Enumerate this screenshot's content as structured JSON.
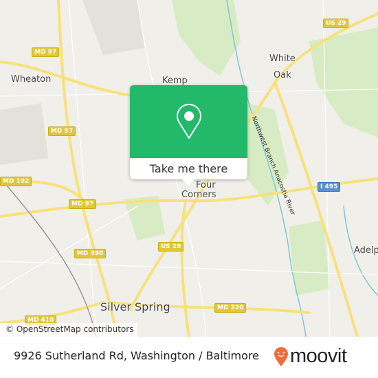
{
  "map": {
    "places": [
      {
        "name": "Wheaton",
        "id": "wheaton"
      },
      {
        "name": "Kemp",
        "id": "kemp"
      },
      {
        "name": "White",
        "id": "white"
      },
      {
        "name": "Oak",
        "id": "oak"
      },
      {
        "name": "Four",
        "id": "four"
      },
      {
        "name": "Corners",
        "id": "corners"
      },
      {
        "name": "Silver Spring",
        "id": "silver-spring"
      },
      {
        "name": "Adelphi",
        "id": "adelphi"
      }
    ],
    "river": "Northwest Branch Anacostia River",
    "shields": [
      "MD 97",
      "US 29",
      "MD 97",
      "MD 192",
      "MD 97",
      "I 495",
      "MD 390",
      "US 29",
      "MD 320",
      "MD 410"
    ],
    "attribution": "© OpenStreetMap contributors",
    "colors": {
      "road": "#f7e27a",
      "park": "#d7ecc4",
      "water": "#7fc6d6",
      "popup": "#22b96a"
    }
  },
  "popup": {
    "icon": "map-pin-icon",
    "cta": "Take me there"
  },
  "footer": {
    "address": "9926 Sutherland Rd, Washington / Baltimore",
    "brand": "moovit",
    "brand_color": "#f36b3c"
  }
}
